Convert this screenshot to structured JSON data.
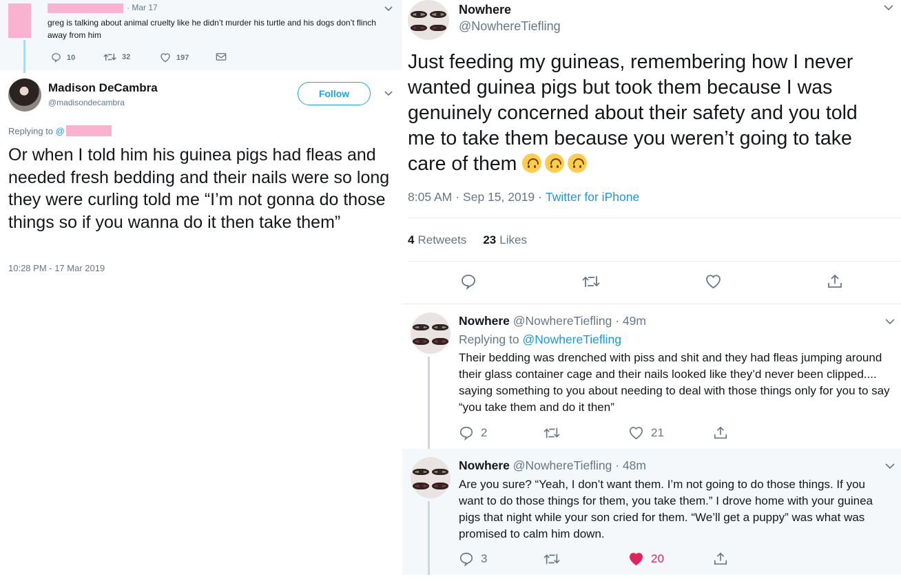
{
  "colors": {
    "link_blue": "#1b95e0",
    "follow_blue": "#1da1f2",
    "muted": "#657786",
    "like_red": "#e0245e",
    "redaction_pink": "#f9b3d0"
  },
  "left": {
    "parent": {
      "time": "· Mar 17",
      "text": "greg is talking about animal cruelty like he didn’t murder his turtle and his dogs don’t flinch away from him",
      "actions": {
        "replies": "10",
        "retweets": "32",
        "likes": "197"
      }
    },
    "tweet": {
      "name": "Madison DeCambra",
      "handle": "@madisondecambra",
      "follow_label": "Follow",
      "replying_to_label": "Replying to",
      "replying_at": "@",
      "text": "Or when I told him his guinea pigs had fleas and needed fresh bedding and their nails were so long they were curling told me “I’m not gonna do those things so if you wanna do it then take them”",
      "timestamp": "10:28 PM - 17 Mar 2019"
    }
  },
  "right": {
    "tweet": {
      "name": "Nowhere",
      "handle": "@NowhereTiefling",
      "text": "Just feeding my guineas, remembering how I never wanted guinea pigs but took them because I was genuinely concerned about their safety and you told me to take them because you weren’t going to take care of them",
      "emoji_count": 3,
      "time": "8:05 AM",
      "date": "Sep 15, 2019",
      "source": "Twitter for iPhone",
      "retweets_count": "4",
      "retweets_label": "Retweets",
      "likes_count": "23",
      "likes_label": "Likes"
    },
    "replies": [
      {
        "name": "Nowhere",
        "handle": "@NowhereTiefling",
        "age": "· 49m",
        "replying_to_label": "Replying to",
        "replying_to": "@NowhereTiefling",
        "text": "Their bedding was drenched with piss and shit and they had fleas jumping around their glass container cage and their nails looked like they’d never been clipped.... saying something to you about needing to deal with those things only for you to say “you take them and do it then”",
        "replies": "2",
        "likes": "21",
        "liked": false
      },
      {
        "name": "Nowhere",
        "handle": "@NowhereTiefling",
        "age": "· 48m",
        "text": "Are you sure? “Yeah, I don’t want them. I’m not going to do those things. If you want to do those things for them, you take them.” I drove home with your guinea pigs that night while your son cried for them. “We’ll get a puppy” was what was promised to calm him down.",
        "replies": "3",
        "likes": "20",
        "liked": true
      }
    ]
  }
}
